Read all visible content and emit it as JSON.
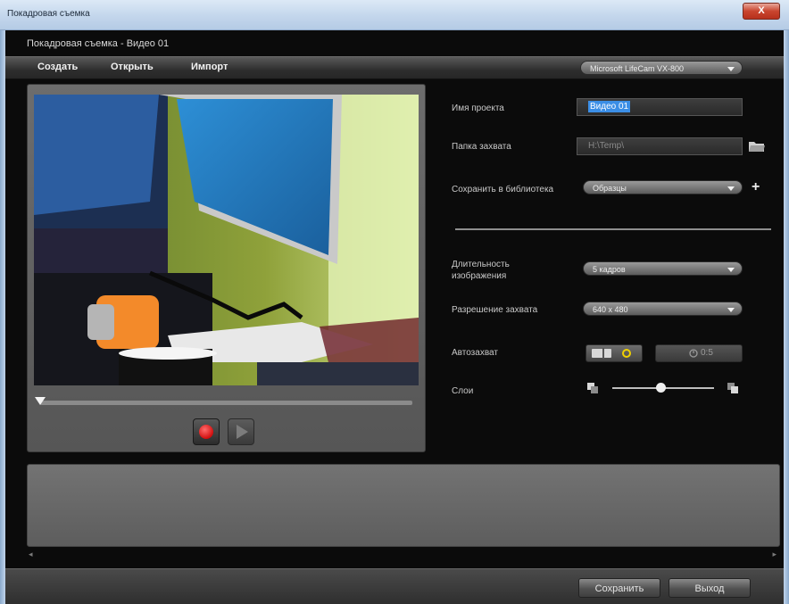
{
  "window": {
    "title": "Покадровая съемка",
    "close_label": "X"
  },
  "app": {
    "subtitle": "Покадровая съемка - Видео 01",
    "menu": {
      "create": "Создать",
      "open": "Открыть",
      "import": "Импорт"
    },
    "camera": {
      "selected": "Microsoft LifeCam VX-800"
    }
  },
  "form": {
    "project_name_label": "Имя проекта",
    "project_name_value": "Видео 01",
    "capture_folder_label": "Папка захвата",
    "capture_folder_value": "H:\\Temp\\",
    "save_to_library_label": "Сохранить в библиотека",
    "save_to_library_value": "Образцы",
    "image_duration_label_1": "Длительность",
    "image_duration_label_2": "изображения",
    "image_duration_value": "5 кадров",
    "capture_resolution_label": "Разрешение захвата",
    "capture_resolution_value": "640 x 480",
    "auto_capture_label": "Автозахват",
    "auto_capture_timer": "0:5",
    "layers_label": "Слои",
    "layers_level": 0.48
  },
  "footer": {
    "save_label": "Сохранить",
    "exit_label": "Выход"
  },
  "colors": {
    "accent": "#3b8ee6",
    "record": "#d20f0f",
    "auto_capture_active": "#f0d000"
  },
  "icons": [
    "close-icon",
    "dropdown-caret-icon",
    "folder-icon",
    "plus-icon",
    "record-icon",
    "play-icon",
    "timer-icon",
    "layer-back-icon",
    "layer-front-icon",
    "scroll-left-icon",
    "scroll-right-icon"
  ]
}
